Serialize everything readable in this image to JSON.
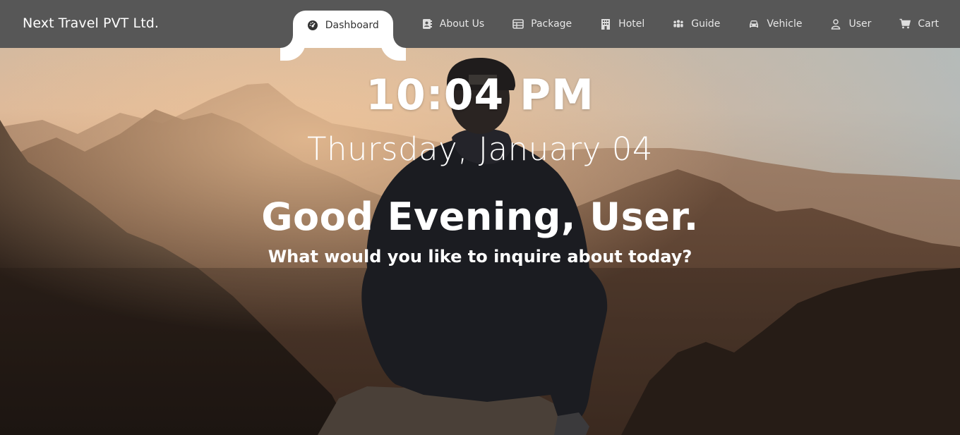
{
  "brand": {
    "name": "Next Travel PVT Ltd."
  },
  "nav": {
    "items": [
      {
        "label": "Dashboard",
        "icon": "dashboard-icon",
        "active": true
      },
      {
        "label": "About Us",
        "icon": "address-book-icon",
        "active": false
      },
      {
        "label": "Package",
        "icon": "table-icon",
        "active": false
      },
      {
        "label": "Hotel",
        "icon": "building-icon",
        "active": false
      },
      {
        "label": "Guide",
        "icon": "users-icon",
        "active": false
      },
      {
        "label": "Vehicle",
        "icon": "car-icon",
        "active": false
      },
      {
        "label": "User",
        "icon": "user-icon",
        "active": false
      },
      {
        "label": "Cart",
        "icon": "cart-icon",
        "active": false
      }
    ]
  },
  "hero": {
    "time": "10:04 PM",
    "date": "Thursday, January 04",
    "greeting": "Good Evening, User.",
    "subtitle": "What would you like to inquire about today?",
    "background": "mountain-sunset-hiker-photo"
  },
  "colors": {
    "navbar": "#575757",
    "active_tab": "#ffffff",
    "text": "#ffffff"
  }
}
